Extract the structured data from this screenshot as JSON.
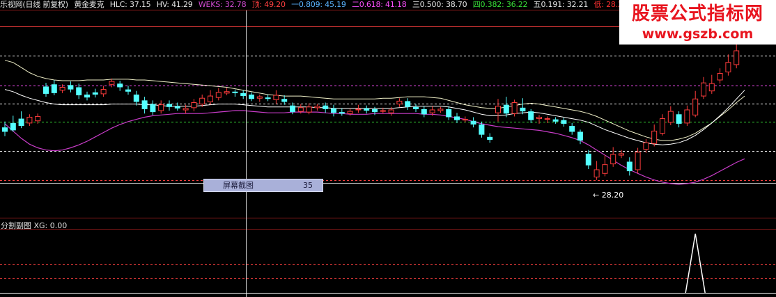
{
  "header": {
    "title": "乐视网(日线 前复权)",
    "indicator": "黄金麦克",
    "hlc": "HLC: 37.15",
    "hv": "HV: 41.29",
    "weks": "WEKS: 32.78",
    "top": "顶: 49.20",
    "f1": "一0.809: 45.19",
    "f2": "二0.618: 41.18",
    "f3": "三0.500: 38.70",
    "f4": "四0.382: 36.22",
    "f5": "五0.191: 32.21",
    "low": "低: 28.2",
    "colors": {
      "title": "#e6e6e6",
      "hlc": "#e6e6e6",
      "hv": "#e6e6e6",
      "weks": "#d24bd2",
      "top": "#ff4040",
      "f1": "#5ab4ff",
      "f2": "#ff50ff",
      "f3": "#e6e6e6",
      "f4": "#38e038",
      "f5": "#e6e6e6",
      "low": "#ff3030"
    }
  },
  "sub_panel": {
    "title": "分割副图",
    "xg": "XG: 0.00"
  },
  "tooltip": {
    "label": "屏幕截图",
    "value": "35"
  },
  "low_marker": "← 28.20",
  "watermark": {
    "title": "股票公式指标网",
    "url": "www.gszb.com"
  },
  "chart_data": {
    "type": "candlestick",
    "y_range": [
      27.6,
      50.0
    ],
    "fib_levels": [
      {
        "name": "顶",
        "value": 49.2,
        "color": "#ff4040",
        "style": "solid"
      },
      {
        "name": "一",
        "value": 45.19,
        "color": "#ffffff",
        "style": "dashed"
      },
      {
        "name": "二",
        "value": 41.18,
        "color": "#ff50ff",
        "style": "dashed"
      },
      {
        "name": "三",
        "value": 38.7,
        "color": "#ffffff",
        "style": "dashed"
      },
      {
        "name": "四",
        "value": 36.22,
        "color": "#38e038",
        "style": "dashed"
      },
      {
        "name": "五",
        "value": 32.21,
        "color": "#ffffff",
        "style": "dashed"
      },
      {
        "name": "低",
        "value": 28.2,
        "color": "#ff4040",
        "style": "dashed"
      }
    ],
    "candles": [
      [
        35.4,
        34.8,
        36.2,
        34.2
      ],
      [
        36.0,
        35.0,
        37.0,
        34.8
      ],
      [
        36.6,
        35.6,
        37.6,
        35.3
      ],
      [
        36.0,
        36.8,
        37.2,
        35.6
      ],
      [
        36.3,
        36.9,
        37.3,
        35.9
      ],
      [
        41.0,
        40.0,
        41.5,
        39.6
      ],
      [
        41.3,
        40.1,
        41.9,
        39.8
      ],
      [
        40.5,
        40.9,
        41.3,
        40.1
      ],
      [
        41.2,
        40.6,
        41.7,
        40.2
      ],
      [
        40.9,
        39.8,
        41.4,
        39.3
      ],
      [
        39.9,
        39.5,
        40.3,
        39.1
      ],
      [
        40.2,
        39.9,
        40.7,
        39.5
      ],
      [
        40.0,
        40.6,
        41.1,
        39.6
      ],
      [
        41.3,
        41.7,
        42.1,
        40.9
      ],
      [
        41.4,
        40.9,
        41.8,
        40.4
      ],
      [
        40.6,
        40.3,
        41.1,
        39.9
      ],
      [
        39.9,
        38.9,
        40.4,
        38.4
      ],
      [
        39.1,
        37.9,
        39.6,
        37.3
      ],
      [
        38.6,
        37.5,
        39.1,
        37.1
      ],
      [
        37.7,
        38.5,
        39.1,
        37.3
      ],
      [
        38.6,
        38.2,
        39.1,
        37.7
      ],
      [
        38.3,
        38.0,
        38.8,
        37.7
      ],
      [
        37.8,
        38.0,
        38.5,
        37.3
      ],
      [
        38.1,
        38.8,
        39.3,
        37.6
      ],
      [
        38.6,
        39.4,
        39.9,
        38.2
      ],
      [
        38.9,
        39.7,
        40.5,
        38.5
      ],
      [
        39.5,
        40.2,
        40.8,
        39.1
      ],
      [
        40.1,
        40.3,
        40.8,
        39.8
      ],
      [
        40.3,
        40.1,
        40.6,
        39.6
      ],
      [
        40.1,
        39.7,
        40.5,
        39.3
      ],
      [
        39.9,
        39.3,
        40.2,
        39.0
      ],
      [
        39.4,
        39.6,
        39.9,
        38.9
      ],
      [
        39.5,
        39.3,
        39.9,
        39.0
      ],
      [
        39.2,
        39.8,
        40.5,
        38.6
      ],
      [
        39.3,
        38.9,
        39.8,
        38.5
      ],
      [
        38.4,
        37.5,
        38.8,
        37.2
      ],
      [
        37.6,
        38.1,
        38.6,
        37.3
      ],
      [
        37.5,
        38.2,
        38.7,
        37.2
      ],
      [
        38.1,
        38.3,
        38.6,
        37.7
      ],
      [
        38.4,
        37.9,
        38.8,
        37.4
      ],
      [
        38.0,
        37.4,
        38.5,
        36.9
      ],
      [
        37.5,
        37.3,
        38.0,
        37.0
      ],
      [
        37.3,
        37.6,
        38.0,
        37.0
      ],
      [
        37.8,
        37.9,
        38.5,
        37.4
      ],
      [
        38.0,
        37.7,
        38.4,
        37.3
      ],
      [
        37.9,
        37.5,
        38.2,
        37.1
      ],
      [
        37.6,
        37.7,
        38.1,
        37.3
      ],
      [
        37.4,
        37.8,
        38.2,
        37.0
      ],
      [
        38.6,
        39.0,
        39.4,
        38.2
      ],
      [
        39.0,
        38.2,
        39.4,
        37.8
      ],
      [
        38.2,
        37.9,
        38.6,
        37.5
      ],
      [
        37.9,
        37.2,
        38.3,
        36.8
      ],
      [
        37.4,
        37.8,
        38.3,
        37.0
      ],
      [
        37.7,
        37.9,
        38.2,
        37.4
      ],
      [
        37.9,
        36.8,
        38.3,
        36.4
      ],
      [
        36.9,
        36.4,
        37.4,
        36.0
      ],
      [
        36.5,
        36.5,
        36.9,
        36.1
      ],
      [
        36.3,
        35.8,
        36.8,
        35.4
      ],
      [
        35.8,
        34.4,
        36.2,
        34.0
      ],
      [
        34.1,
        33.7,
        34.6,
        33.3
      ],
      [
        37.4,
        38.3,
        39.3,
        36.2
      ],
      [
        38.5,
        37.3,
        39.6,
        36.8
      ],
      [
        37.3,
        38.8,
        39.2,
        36.9
      ],
      [
        38.1,
        37.6,
        39.4,
        37.2
      ],
      [
        37.6,
        36.4,
        37.9,
        36.0
      ],
      [
        36.6,
        36.8,
        37.1,
        35.9
      ],
      [
        36.5,
        36.6,
        36.9,
        36.0
      ],
      [
        36.5,
        36.2,
        36.8,
        35.9
      ],
      [
        36.4,
        35.9,
        36.7,
        35.5
      ],
      [
        35.6,
        34.8,
        36.0,
        34.4
      ],
      [
        34.8,
        33.6,
        35.1,
        33.1
      ],
      [
        31.8,
        30.2,
        32.3,
        29.7
      ],
      [
        28.6,
        29.6,
        30.8,
        28.2
      ],
      [
        29.1,
        30.3,
        31.6,
        28.7
      ],
      [
        30.4,
        31.7,
        32.7,
        30.0
      ],
      [
        31.6,
        31.8,
        32.3,
        31.2
      ],
      [
        30.7,
        29.4,
        31.3,
        28.8
      ],
      [
        29.6,
        32.0,
        32.6,
        29.1
      ],
      [
        32.4,
        33.3,
        33.8,
        31.9
      ],
      [
        33.2,
        34.9,
        35.8,
        32.8
      ],
      [
        34.6,
        36.6,
        37.2,
        34.3
      ],
      [
        36.1,
        37.6,
        38.3,
        35.7
      ],
      [
        37.2,
        35.9,
        37.6,
        35.4
      ],
      [
        36.0,
        37.8,
        38.4,
        35.6
      ],
      [
        37.1,
        39.3,
        40.4,
        36.8
      ],
      [
        39.7,
        41.5,
        42.3,
        39.3
      ],
      [
        40.4,
        41.4,
        42.6,
        40.0
      ],
      [
        41.9,
        42.8,
        43.5,
        41.4
      ],
      [
        43.0,
        44.3,
        45.4,
        42.5
      ],
      [
        44.0,
        45.9,
        47.1,
        43.5
      ],
      [
        47.5,
        49.6,
        51.0,
        47.0
      ]
    ],
    "ma_white": [
      44.6,
      44.3,
      43.6,
      42.9,
      42.4,
      42.1,
      41.9,
      41.8,
      41.8,
      41.8,
      41.9,
      41.9,
      41.9,
      42.0,
      42.0,
      42.0,
      41.9,
      41.9,
      41.8,
      41.7,
      41.6,
      41.5,
      41.4,
      41.3,
      41.2,
      41.1,
      41.0,
      40.9,
      40.7,
      40.5,
      40.3,
      40.1,
      39.9,
      39.8,
      39.7,
      39.7,
      39.7,
      39.6,
      39.5,
      39.4,
      39.3,
      39.3,
      39.3,
      39.3,
      39.3,
      39.3,
      39.4,
      39.4,
      39.5,
      39.6,
      39.6,
      39.6,
      39.5,
      39.4,
      39.1,
      38.8,
      38.5,
      38.3,
      38.1,
      38.0,
      38.0,
      38.2,
      38.4,
      38.6,
      38.7,
      38.6,
      38.4,
      38.2,
      38.0,
      37.8,
      37.6,
      37.3,
      36.9,
      36.4,
      35.9,
      35.4,
      34.9,
      34.5,
      34.1,
      33.8,
      33.6,
      33.6,
      33.8,
      34.1,
      34.6,
      35.3,
      36.0,
      36.9,
      37.8,
      38.8,
      39.7
    ],
    "ma_white2": [
      40.6,
      40.3,
      39.8,
      39.4,
      39.1,
      38.8,
      38.6,
      38.5,
      38.5,
      38.5,
      38.5,
      38.5,
      38.5,
      38.6,
      38.6,
      38.6,
      38.6,
      38.5,
      38.5,
      38.4,
      38.3,
      38.3,
      38.3,
      38.3,
      38.4,
      38.5,
      38.6,
      38.6,
      38.6,
      38.5,
      38.4,
      38.3,
      38.2,
      38.2,
      38.2,
      38.2,
      38.2,
      38.2,
      38.1,
      38.1,
      38.0,
      38.0,
      38.0,
      38.0,
      38.0,
      38.0,
      38.0,
      38.0,
      38.1,
      38.2,
      38.3,
      38.3,
      38.3,
      38.3,
      38.2,
      38.0,
      37.8,
      37.5,
      37.2,
      37.0,
      37.0,
      37.1,
      37.3,
      37.4,
      37.5,
      37.4,
      37.2,
      37.0,
      36.8,
      36.6,
      36.4,
      36.1,
      35.6,
      35.1,
      34.7,
      34.3,
      33.9,
      33.6,
      33.3,
      33.1,
      33.0,
      33.1,
      33.3,
      33.7,
      34.3,
      35.1,
      36.0,
      37.0,
      38.1,
      39.3,
      40.5
    ],
    "ma_purple": [
      35.9,
      34.9,
      33.9,
      33.1,
      32.6,
      32.3,
      32.2,
      32.3,
      32.6,
      33.0,
      33.5,
      34.1,
      34.7,
      35.3,
      35.8,
      36.2,
      36.5,
      36.8,
      37.0,
      37.1,
      37.2,
      37.3,
      37.3,
      37.3,
      37.3,
      37.4,
      37.5,
      37.6,
      37.7,
      37.7,
      37.6,
      37.5,
      37.4,
      37.4,
      37.4,
      37.5,
      37.5,
      37.5,
      37.5,
      37.4,
      37.3,
      37.3,
      37.2,
      37.2,
      37.2,
      37.3,
      37.3,
      37.3,
      37.3,
      37.3,
      37.3,
      37.2,
      37.2,
      37.1,
      36.9,
      36.7,
      36.5,
      36.2,
      35.9,
      35.7,
      35.5,
      35.4,
      35.3,
      35.2,
      35.1,
      35.0,
      34.8,
      34.6,
      34.3,
      34.0,
      33.6,
      33.0,
      32.3,
      31.6,
      30.9,
      30.2,
      29.6,
      29.1,
      28.6,
      28.2,
      27.9,
      27.7,
      27.6,
      27.7,
      27.9,
      28.3,
      28.8,
      29.4,
      30.0,
      30.6,
      31.1
    ],
    "xg_peak_index": 84
  }
}
